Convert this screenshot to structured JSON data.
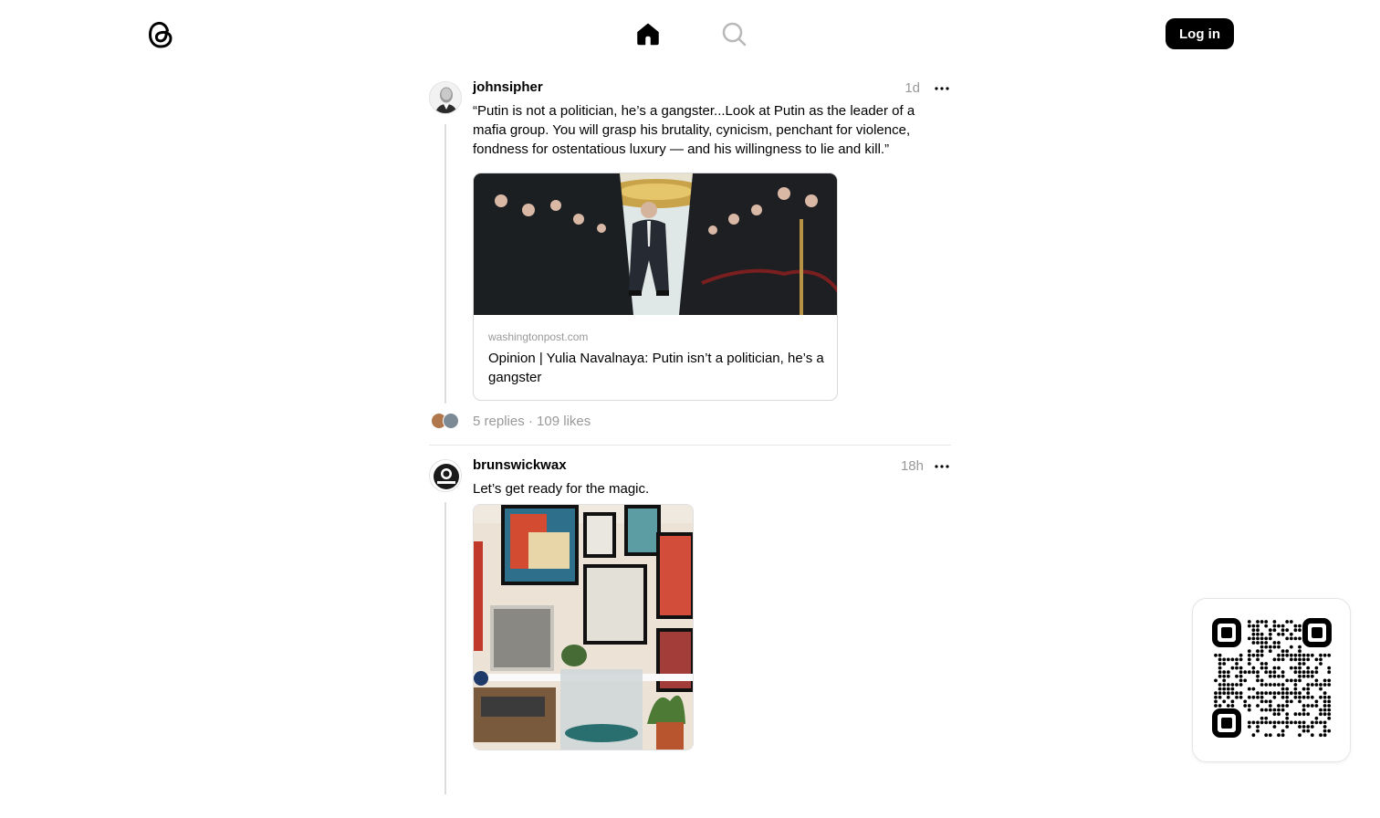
{
  "header": {
    "logo_icon": "threads-logo-icon",
    "home_icon": "home-icon",
    "search_icon": "search-icon",
    "login_label": "Log in"
  },
  "posts": [
    {
      "username": "johnsipher",
      "time": "1d",
      "caption": "“Putin is not a politician, he’s a gangster...Look at Putin as the leader of a mafia group. You will grasp his brutality, cynicism, penchant for violence, fondness for ostentatious luxury — and his willingness to lie and kill.”",
      "link": {
        "domain": "washingtonpost.com",
        "title": "Opinion | Yulia Navalnaya: Putin isn’t a politician, he’s a gangster"
      },
      "replies": "5 replies",
      "separator": "·",
      "likes": "109 likes"
    },
    {
      "username": "brunswickwax",
      "time": "18h",
      "caption": "Let’s get ready for the magic."
    }
  ],
  "qr_code": {
    "icon": "qr-code-icon"
  }
}
